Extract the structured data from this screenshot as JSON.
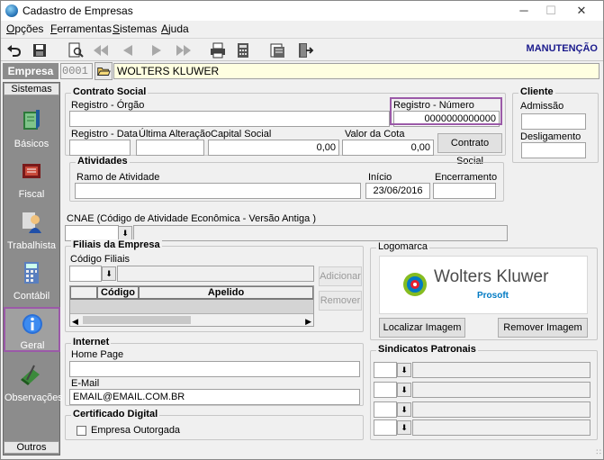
{
  "window": {
    "title": "Cadastro de Empresas",
    "controls": [
      "─",
      "☐",
      "✕"
    ]
  },
  "menu": [
    {
      "label": "Opções",
      "underline": "O",
      "rest": "pções"
    },
    {
      "label": "Ferramentas",
      "underline": "F",
      "rest": "erramentas"
    },
    {
      "label": "Sistemas",
      "underline": "S",
      "rest": "istemas"
    },
    {
      "label": "Ajuda",
      "underline": "A",
      "rest": "juda"
    }
  ],
  "toolbar": {
    "icons": [
      "undo-icon",
      "save-icon",
      "preview-icon",
      "first-record-icon",
      "previous-record-icon",
      "next-record-icon",
      "last-record-icon",
      "print-icon",
      "calculator-icon",
      "reports-icon",
      "exit-icon"
    ],
    "mode": "MANUTENÇÃO"
  },
  "empresa": {
    "label": "Empresa",
    "code": "0001",
    "name": "WOLTERS KLUWER"
  },
  "sidebar": {
    "header": "Sistemas",
    "footer": "Outros",
    "items": [
      {
        "label": "Básicos",
        "icon": "book-icon"
      },
      {
        "label": "Fiscal",
        "icon": "fiscal-icon"
      },
      {
        "label": "Trabalhista",
        "icon": "worker-icon"
      },
      {
        "label": "Contábil",
        "icon": "calculator-icon"
      },
      {
        "label": "Geral",
        "icon": "info-icon"
      },
      {
        "label": "Observações",
        "icon": "notes-icon"
      }
    ]
  },
  "contrato": {
    "title": "Contrato Social",
    "registro_orgao_label": "Registro - Órgão",
    "registro_numero_label": "Registro - Número",
    "registro_numero_value": "0000000000000",
    "registro_data_label": "Registro - Data",
    "ultima_alteracao_label": "Última Alteração",
    "capital_social_label": "Capital Social",
    "capital_social_value": "0,00",
    "valor_cota_label": "Valor da Cota",
    "valor_cota_value": "0,00",
    "contrato_button": "Contrato Social"
  },
  "atividades": {
    "title": "Atividades",
    "ramo_label": "Ramo de Atividade",
    "inicio_label": "Início",
    "inicio_value": "23/06/2016",
    "encerramento_label": "Encerramento"
  },
  "cliente": {
    "title": "Cliente",
    "admissao_label": "Admissão",
    "desligamento_label": "Desligamento"
  },
  "cnae": {
    "label": "CNAE (Código de Atividade Econômica - Versão Antiga )"
  },
  "filiais": {
    "title": "Filiais da Empresa",
    "codigo_label": "Código Filiais",
    "columns": [
      "Código",
      "Apelido"
    ],
    "add_button": "Adicionar",
    "remove_button": "Remover"
  },
  "logomarca": {
    "title": "Logomarca",
    "brand": "Wolters Kluwer",
    "sub": "Prosoft",
    "locate_button": "Localizar Imagem",
    "remove_button": "Remover Imagem"
  },
  "internet": {
    "title": "Internet",
    "homepage_label": "Home Page",
    "email_label": "E-Mail",
    "email_value": "EMAIL@EMAIL.COM.BR"
  },
  "sindicatos": {
    "title": "Sindicatos Patronais"
  },
  "certificado": {
    "title": "Certificado Digital",
    "checkbox_label": "Empresa Outorgada",
    "checked": false
  },
  "colors": {
    "highlight": "#9b5aa8",
    "mode_text": "#1a1a8c",
    "sidebar_bg": "#8c8c8c",
    "name_bg": "#ffffe1"
  }
}
